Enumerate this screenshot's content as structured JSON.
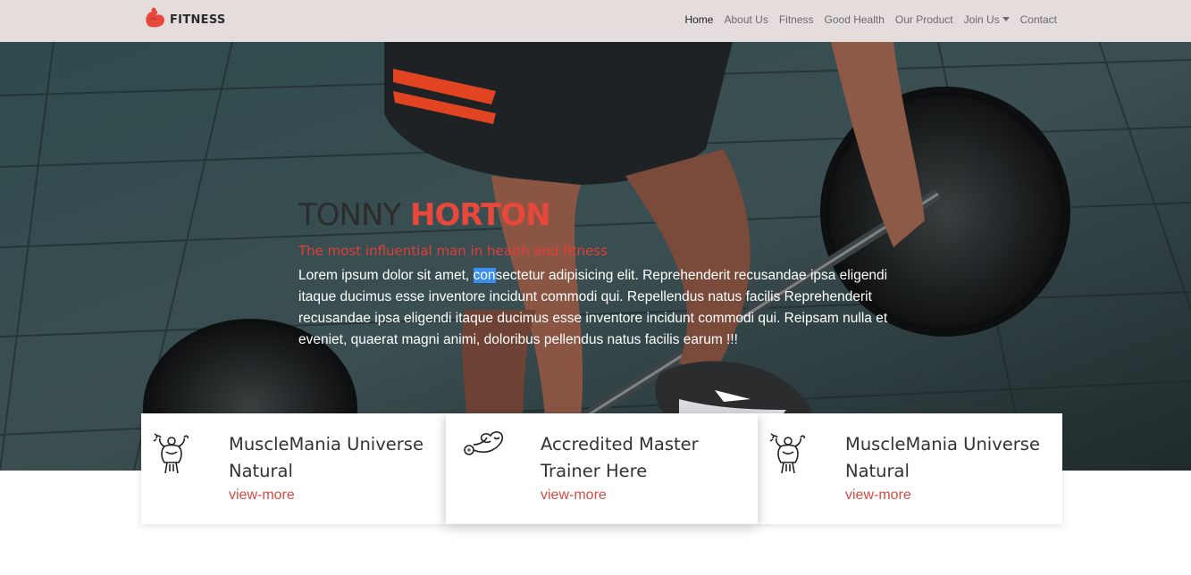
{
  "brand": {
    "name": "FITNESS",
    "logo_icon": "muscle-arm-logo-icon",
    "accent": "#e8473b"
  },
  "nav": {
    "items": [
      {
        "label": "Home",
        "active": true
      },
      {
        "label": "About Us"
      },
      {
        "label": "Fitness"
      },
      {
        "label": "Good Health"
      },
      {
        "label": "Our Product"
      },
      {
        "label": "Join Us",
        "dropdown": true
      },
      {
        "label": "Contact"
      }
    ]
  },
  "hero": {
    "title_first": "TONNY",
    "title_last": "HORTON",
    "subtitle": "The most influential man in health and fitness",
    "para_highlight_before": "Lorem ipsum dolor sit amet, ",
    "para_highlight": "con",
    "para_rest": "sectetur adipisicing elit. Reprehenderit recusandae ipsa eligendi itaque ducimus esse inventore incidunt commodi qui. Repellendus natus facilis Reprehenderit recusandae ipsa eligendi itaque ducimus esse inventore incidunt commodi qui. Reipsam nulla et eveniet, quaerat magni animi, doloribus pellendus natus facilis earum !!!"
  },
  "cards": [
    {
      "title": "MuscleMania Universe Natural",
      "link": "view-more",
      "icon": "bodybuilder-icon"
    },
    {
      "title": "Accredited Master Trainer Here",
      "link": "view-more",
      "icon": "flexing-arm-icon"
    },
    {
      "title": "MuscleMania Universe Natural",
      "link": "view-more",
      "icon": "bodybuilder-icon"
    }
  ]
}
